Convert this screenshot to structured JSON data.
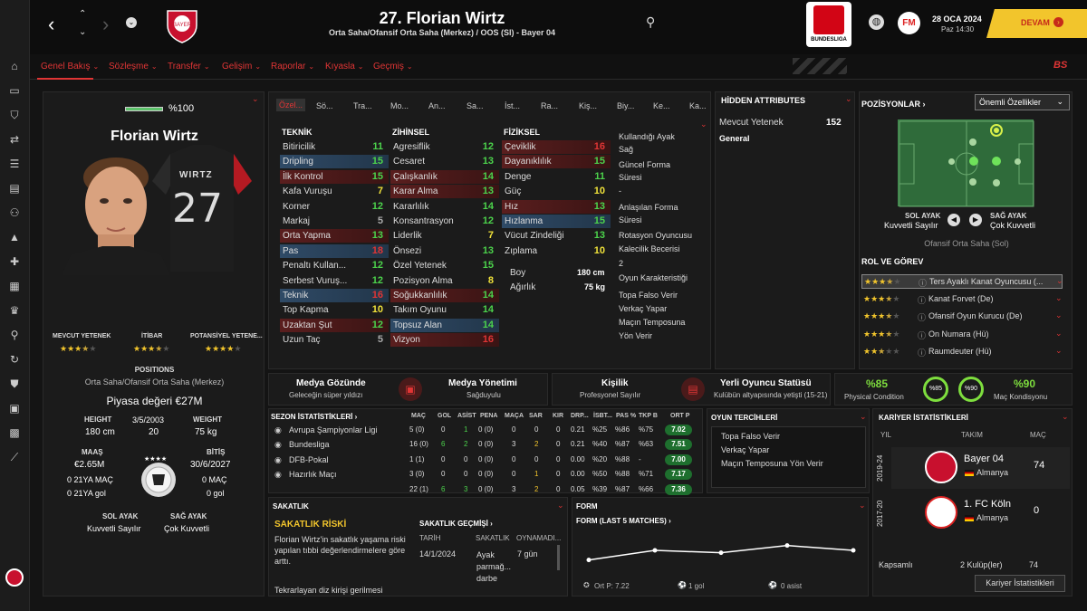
{
  "sidebar": {
    "icons": [
      "home-icon",
      "inbox-icon",
      "shirt-icon",
      "transfer-icon",
      "tactics-icon",
      "clipboard-icon",
      "people-icon",
      "training-icon",
      "medical-icon",
      "calendar-icon",
      "trophy-icon",
      "search-icon",
      "refresh-icon",
      "shield-icon",
      "briefcase-icon",
      "money-icon",
      "chart-icon"
    ]
  },
  "header": {
    "title": "27. Florian Wirtz",
    "subtitle": "Orta Saha/Ofansif Orta Saha (Merkez) / OOS (Sl) - Bayer 04",
    "league_logo_text": "BUNDESLIGA",
    "date": "28 OCA 2024",
    "time": "Paz 14:30",
    "continue_label": "DEVAM",
    "fm_logo": "FM"
  },
  "nav": {
    "tabs": [
      "Genel Bakış",
      "Sözleşme",
      "Transfer",
      "Gelişim",
      "Raporlar",
      "Kıyasla",
      "Geçmiş"
    ],
    "badge": "BS"
  },
  "profile": {
    "fitness": "%100",
    "name": "Florian Wirtz",
    "shirt_name": "WIRTZ",
    "shirt_number": "27",
    "ability_labels": [
      "MEVCUT YETENEK",
      "İTİBAR",
      "POTANSİYEL YETENE..."
    ],
    "ability_stars": [
      3.5,
      3.5,
      4
    ],
    "positions_label": "POSITIONS",
    "positions_value": "Orta Saha/Ofansif Orta Saha (Merkez)",
    "market_value": "Piyasa değeri €27M",
    "height_label": "HEIGHT",
    "height": "180 cm",
    "dob": "3/5/2003",
    "age": "20",
    "weight_label": "WEIGHT",
    "weight": "75 kg",
    "wage_label": "MAAŞ",
    "wage": "€2.65M",
    "u21_matches_label_left": "0 21YA MAÇ",
    "u21_goals_left": "0 21YA gol",
    "expiry_label": "BİTİŞ",
    "expiry": "30/6/2027",
    "right_matches": "0 MAÇ",
    "right_goals": "0 gol",
    "left_foot_label": "SOL AYAK",
    "left_foot": "Kuvvetli Sayılır",
    "right_foot_label": "SAĞ AYAK",
    "right_foot": "Çok Kuvvetli"
  },
  "attr_tabs": [
    "Özel...",
    "Sö...",
    "Tra...",
    "Mo...",
    "An...",
    "Sa...",
    "İst...",
    "Ra...",
    "Kiş...",
    "Bi...",
    "Biy...",
    "Ke...",
    "Ka..."
  ],
  "attributes": {
    "technical_title": "TEKNİK",
    "technical": [
      {
        "n": "Bitiricilik",
        "v": "11",
        "c": "v-green",
        "h": ""
      },
      {
        "n": "Dripling",
        "v": "15",
        "c": "v-green",
        "h": "hl-blue"
      },
      {
        "n": "İlk Kontrol",
        "v": "15",
        "c": "v-green",
        "h": "hl-red"
      },
      {
        "n": "Kafa Vuruşu",
        "v": "7",
        "c": "v-yellow",
        "h": ""
      },
      {
        "n": "Korner",
        "v": "12",
        "c": "v-green",
        "h": ""
      },
      {
        "n": "Markaj",
        "v": "5",
        "c": "v-gray",
        "h": ""
      },
      {
        "n": "Orta Yapma",
        "v": "13",
        "c": "v-green",
        "h": "hl-red"
      },
      {
        "n": "Pas",
        "v": "18",
        "c": "v-red",
        "h": "hl-blue"
      },
      {
        "n": "Penaltı Kullan...",
        "v": "12",
        "c": "v-green",
        "h": ""
      },
      {
        "n": "Serbest Vuruş...",
        "v": "12",
        "c": "v-green",
        "h": ""
      },
      {
        "n": "Teknik",
        "v": "16",
        "c": "v-red",
        "h": "hl-blue"
      },
      {
        "n": "Top Kapma",
        "v": "10",
        "c": "v-yellow",
        "h": ""
      },
      {
        "n": "Uzaktan Şut",
        "v": "12",
        "c": "v-green",
        "h": "hl-red"
      },
      {
        "n": "Uzun Taç",
        "v": "5",
        "c": "v-gray",
        "h": ""
      }
    ],
    "mental_title": "ZİHİNSEL",
    "mental": [
      {
        "n": "Agresiflik",
        "v": "12",
        "c": "v-green",
        "h": ""
      },
      {
        "n": "Cesaret",
        "v": "13",
        "c": "v-green",
        "h": ""
      },
      {
        "n": "Çalışkanlık",
        "v": "14",
        "c": "v-green",
        "h": "hl-red"
      },
      {
        "n": "Karar Alma",
        "v": "13",
        "c": "v-green",
        "h": "hl-red"
      },
      {
        "n": "Kararlılık",
        "v": "14",
        "c": "v-green",
        "h": ""
      },
      {
        "n": "Konsantrasyon",
        "v": "12",
        "c": "v-green",
        "h": ""
      },
      {
        "n": "Liderlik",
        "v": "7",
        "c": "v-yellow",
        "h": ""
      },
      {
        "n": "Önsezi",
        "v": "13",
        "c": "v-green",
        "h": ""
      },
      {
        "n": "Özel Yetenek",
        "v": "15",
        "c": "v-green",
        "h": ""
      },
      {
        "n": "Pozisyon Alma",
        "v": "8",
        "c": "v-yellow",
        "h": ""
      },
      {
        "n": "Soğukkanlılık",
        "v": "14",
        "c": "v-green",
        "h": "hl-red"
      },
      {
        "n": "Takım Oyunu",
        "v": "14",
        "c": "v-green",
        "h": ""
      },
      {
        "n": "Topsuz Alan",
        "v": "14",
        "c": "v-green",
        "h": "hl-blue"
      },
      {
        "n": "Vizyon",
        "v": "16",
        "c": "v-red",
        "h": "hl-red"
      }
    ],
    "physical_title": "FİZİKSEL",
    "physical": [
      {
        "n": "Çeviklik",
        "v": "16",
        "c": "v-red",
        "h": "hl-red"
      },
      {
        "n": "Dayanıklılık",
        "v": "15",
        "c": "v-green",
        "h": "hl-red"
      },
      {
        "n": "Denge",
        "v": "11",
        "c": "v-green",
        "h": ""
      },
      {
        "n": "Güç",
        "v": "10",
        "c": "v-yellow",
        "h": ""
      },
      {
        "n": "Hız",
        "v": "13",
        "c": "v-green",
        "h": "hl-red"
      },
      {
        "n": "Hızlanma",
        "v": "15",
        "c": "v-green",
        "h": "hl-blue"
      },
      {
        "n": "Vücut Zindeliği",
        "v": "13",
        "c": "v-green",
        "h": ""
      },
      {
        "n": "Zıplama",
        "v": "10",
        "c": "v-yellow",
        "h": ""
      }
    ],
    "boy_label": "Boy",
    "boy": "180 cm",
    "agirlik_label": "Ağırlık",
    "agirlik": "75 kg"
  },
  "info_col": [
    "Kullandığı Ayak",
    "Sağ",
    "Güncel Forma",
    "Süresi",
    "-",
    "Anlaşılan Forma",
    "Süresi",
    "Rotasyon Oyuncusu",
    "Kalecilik Becerisi",
    "2",
    "Oyun Karakteristiği",
    "Topa Falso Verir",
    "Verkaç Yapar",
    "Maçın Temposuna",
    "Yön Verir"
  ],
  "hidden": {
    "title": "HİDDEN ATTRIBUTES",
    "ca_label": "Mevcut Yetenek",
    "ca": "152",
    "general": "General"
  },
  "positions": {
    "title": "POZİSYONLAR ›",
    "dropdown": "Önemli Özellikler",
    "left_foot_label": "SOL AYAK",
    "left_foot": "Kuvvetli Sayılır",
    "right_foot_label": "SAĞ AYAK",
    "right_foot": "Çok Kuvvetli",
    "role_caption": "Ofansif Orta Saha (Sol)",
    "roles_title": "ROL VE GÖREV",
    "roles": [
      {
        "n": "Ters Ayaklı Kanat Oyuncusu (...",
        "s": 3.5
      },
      {
        "n": "Kanat Forvet (De)",
        "s": 3.5
      },
      {
        "n": "Ofansif Oyun Kurucu (De)",
        "s": 3.5
      },
      {
        "n": "On Numara (Hü)",
        "s": 3.5
      },
      {
        "n": "Raumdeuter (Hü)",
        "s": 2.5
      }
    ]
  },
  "media": {
    "m1_title": "Medya Gözünde",
    "m1_sub": "Geleceğin süper yıldızı",
    "m2_title": "Medya Yönetimi",
    "m2_sub": "Sağduyulu",
    "m3_title": "Kişilik",
    "m3_sub": "Profesyonel Sayılır",
    "m4_title": "Yerli Oyuncu Statüsü",
    "m4_sub": "Kulübün altyapısında yetişti (15-21)",
    "cond": "%85",
    "cond_label": "Physical Condition",
    "cond_ring": "%85",
    "match_ring": "%90",
    "match": "%90",
    "match_label": "Maç Kondisyonu"
  },
  "season": {
    "title": "SEZON İSTATİSTİKLERİ ›",
    "cols": [
      "MAÇ",
      "GOL",
      "ASİST",
      "PENA",
      "MAÇA",
      "SAR",
      "KIR",
      "DRP...",
      "İSBT...",
      "PAS %",
      "TKP B",
      "ORT P"
    ],
    "rows": [
      {
        "c": "Avrupa Şampiyonlar Ligi",
        "v": [
          "5 (0)",
          "0",
          "1",
          "0 (0)",
          "0",
          "0",
          "0",
          "0.21",
          "%25",
          "%86",
          "%75"
        ],
        "r": "7.02"
      },
      {
        "c": "Bundesliga",
        "v": [
          "16 (0)",
          "6",
          "2",
          "0 (0)",
          "3",
          "2",
          "0",
          "0.21",
          "%40",
          "%87",
          "%63"
        ],
        "r": "7.51"
      },
      {
        "c": "DFB-Pokal",
        "v": [
          "1 (1)",
          "0",
          "0",
          "0 (0)",
          "0",
          "0",
          "0",
          "0.00",
          "%20",
          "%88",
          "-"
        ],
        "r": "7.00"
      },
      {
        "c": "Hazırlık Maçı",
        "v": [
          "3 (0)",
          "0",
          "0",
          "0 (0)",
          "0",
          "1",
          "0",
          "0.00",
          "%50",
          "%88",
          "%71"
        ],
        "r": "7.17"
      },
      {
        "c": "",
        "v": [
          "22 (1)",
          "6",
          "3",
          "0 (0)",
          "3",
          "2",
          "0",
          "0.05",
          "%39",
          "%87",
          "%66"
        ],
        "r": "7.36"
      }
    ]
  },
  "prefs": {
    "title": "OYUN TERCİHLERİ",
    "items": [
      "Topa Falso Verir",
      "Verkaç Yapar",
      "Maçın Temposuna Yön Verir"
    ]
  },
  "career": {
    "title": "KARİYER İSTATİSTİKLERİ",
    "col_year": "YIL",
    "col_team": "TAKIM",
    "col_apps": "MAÇ",
    "rows": [
      {
        "year": "2019-24",
        "team": "Bayer 04",
        "country": "Almanya",
        "apps": "74"
      },
      {
        "year": "2017-20",
        "team": "1. FC Köln",
        "country": "Almanya",
        "apps": "0"
      }
    ],
    "total_label": "Kapsamlı",
    "total_clubs": "2 Kulüp(ler)",
    "total_apps": "74",
    "button": "Kariyer İstatistikleri"
  },
  "injury": {
    "title": "SAKATLIK",
    "risk_title": "SAKATLIK RİSKİ",
    "risk_text": "Florian Wirtz'in sakatlık yaşama riski yapılan tıbbi değerlendirmelere göre arttı.",
    "more_text": "Tekrarlayan diz kirişi gerilmesi",
    "history_title": "SAKATLIK GEÇMİŞİ ›",
    "col_date": "TARİH",
    "col_injury": "SAKATLIK",
    "col_missed": "OYNAMADI...",
    "rows": [
      {
        "d": "14/1/2024",
        "i": "Ayak parmağ... darbe",
        "m": "7 gün"
      }
    ]
  },
  "form": {
    "title": "FORM",
    "subtitle": "FORM (LAST 5 MATCHES) ›",
    "values": [
      7.0,
      7.4,
      7.3,
      7.6,
      7.4
    ],
    "avg": "Ort P: 7.22",
    "goals": "1 gol",
    "assists": "0 asist"
  },
  "colors": {
    "accent": "#e03535",
    "gold": "#f2c52c",
    "green": "#4cd34c"
  }
}
